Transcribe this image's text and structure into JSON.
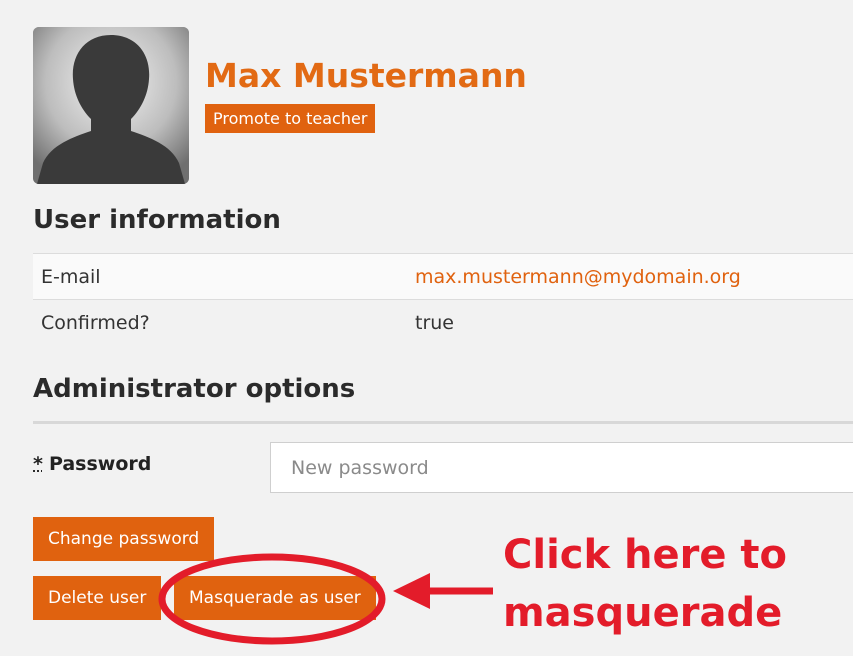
{
  "profile": {
    "name": "Max Mustermann",
    "promote_label": "Promote to teacher",
    "avatar_icon": "person-silhouette-icon"
  },
  "user_info": {
    "heading": "User information",
    "rows": [
      {
        "label": "E-mail",
        "value": "max.mustermann@mydomain.org"
      },
      {
        "label": "Confirmed?",
        "value": "true"
      }
    ]
  },
  "admin": {
    "heading": "Administrator options",
    "password_required_marker": "*",
    "password_label": "Password",
    "password_placeholder": "New password",
    "password_value": "",
    "change_password_label": "Change password",
    "delete_user_label": "Delete user",
    "masquerade_label": "Masquerade as user"
  },
  "annotation": {
    "line1": "Click here to",
    "line2": "masquerade",
    "color": "#e31c2a"
  },
  "colors": {
    "accent": "#e0620f",
    "name_color": "#e26a14",
    "background": "#f2f2f2"
  }
}
